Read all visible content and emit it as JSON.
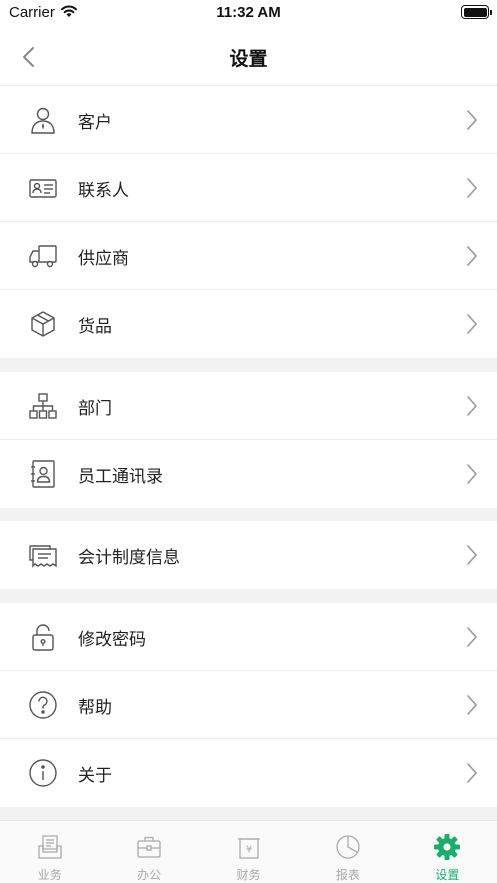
{
  "status": {
    "carrier": "Carrier",
    "time": "11:32 AM"
  },
  "nav": {
    "title": "设置"
  },
  "groups": [
    {
      "items": [
        {
          "label": "客户",
          "icon": "customer-icon"
        },
        {
          "label": "联系人",
          "icon": "contact-card-icon"
        },
        {
          "label": "供应商",
          "icon": "truck-icon"
        },
        {
          "label": "货品",
          "icon": "package-icon"
        }
      ]
    },
    {
      "items": [
        {
          "label": "部门",
          "icon": "org-chart-icon"
        },
        {
          "label": "员工通讯录",
          "icon": "address-book-icon"
        }
      ]
    },
    {
      "items": [
        {
          "label": "会计制度信息",
          "icon": "receipt-icon"
        }
      ]
    },
    {
      "items": [
        {
          "label": "修改密码",
          "icon": "lock-icon"
        },
        {
          "label": "帮助",
          "icon": "help-icon"
        },
        {
          "label": "关于",
          "icon": "info-icon"
        }
      ]
    }
  ],
  "tabs": [
    {
      "label": "业务",
      "icon": "business-icon",
      "active": false
    },
    {
      "label": "办公",
      "icon": "briefcase-icon",
      "active": false
    },
    {
      "label": "财务",
      "icon": "finance-icon",
      "active": false
    },
    {
      "label": "报表",
      "icon": "pie-chart-icon",
      "active": false
    },
    {
      "label": "设置",
      "icon": "gear-icon",
      "active": true
    }
  ],
  "colors": {
    "accent": "#1aad6e",
    "inactive": "#aaaaaa",
    "separator": "#f2f2f2",
    "icon": "#555555"
  }
}
